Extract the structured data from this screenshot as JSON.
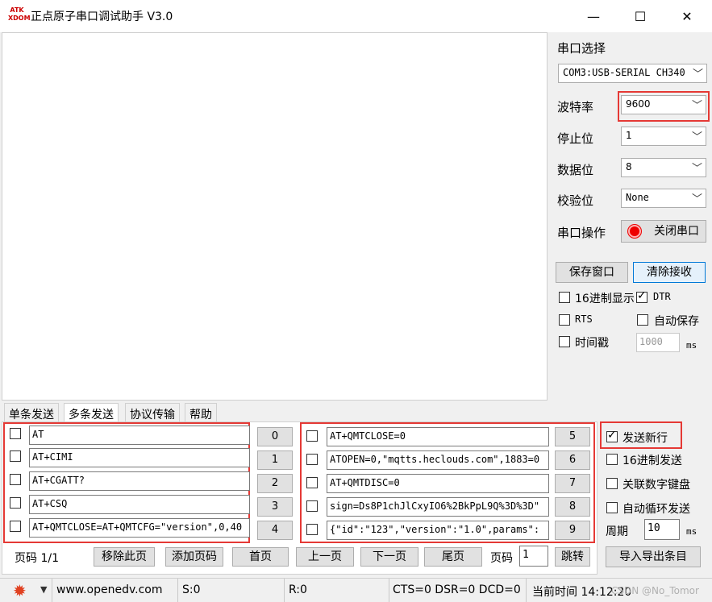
{
  "window": {
    "logo_text": "ATK XDOM",
    "title": "正点原子串口调试助手 V3.0",
    "minimize": "—",
    "maximize": "☐",
    "close": "✕"
  },
  "settings": {
    "port_select_label": "串口选择",
    "port_value": "COM3:USB-SERIAL CH340",
    "baud_label": "波特率",
    "baud_value": "9600",
    "stop_label": "停止位",
    "stop_value": "1",
    "data_label": "数据位",
    "data_value": "8",
    "parity_label": "校验位",
    "parity_value": "None",
    "port_op_label": "串口操作",
    "close_port_button": "关闭串口",
    "save_window_button": "保存窗口",
    "clear_recv_button": "清除接收",
    "hex_display": "16进制显示",
    "dtr": "DTR",
    "rts": "RTS",
    "auto_save": "自动保存",
    "timestamp": "时间戳",
    "timestamp_value": "1000",
    "timestamp_unit": "ms"
  },
  "tabs": [
    {
      "label": "单条发送",
      "active": false
    },
    {
      "label": "多条发送",
      "active": true
    },
    {
      "label": "协议传输",
      "active": false
    },
    {
      "label": "帮助",
      "active": false
    }
  ],
  "multi_send": {
    "left": [
      {
        "text": "AT",
        "num": "0"
      },
      {
        "text": "AT+CIMI",
        "num": "1"
      },
      {
        "text": "AT+CGATT?",
        "num": "2"
      },
      {
        "text": "AT+CSQ",
        "num": "3"
      },
      {
        "text": "AT+QMTCLOSE=AT+QMTCFG=\"version\",0,40",
        "num": "4"
      }
    ],
    "right": [
      {
        "text": "AT+QMTCLOSE=0",
        "num": "5"
      },
      {
        "text": "ATOPEN=0,\"mqtts.heclouds.com\",1883=0",
        "num": "6"
      },
      {
        "text": "AT+QMTDISC=0",
        "num": "7"
      },
      {
        "text": "sign=Ds8P1chJlCxyIO6%2BkPpL9Q%3D%3D\"",
        "num": "8"
      },
      {
        "text": "{\"id\":\"123\",\"version\":\"1.0\",params\":",
        "num": "9"
      }
    ],
    "send_newline": "发送新行",
    "hex_send": "16进制发送",
    "link_keypad": "关联数字键盘",
    "auto_loop": "自动循环发送",
    "period_label": "周期",
    "period_value": "10",
    "period_unit": "ms"
  },
  "pager": {
    "page_info": "页码 1/1",
    "remove_page": "移除此页",
    "add_page": "添加页码",
    "first": "首页",
    "prev": "上一页",
    "next": "下一页",
    "last": "尾页",
    "page_label": "页码",
    "page_value": "1",
    "jump": "跳转",
    "import_export": "导入导出条目"
  },
  "status": {
    "website": "www.openedv.com",
    "sent": "S:0",
    "recv": "R:0",
    "signals": "CTS=0 DSR=0 DCD=0",
    "time": "当前时间 14:12:20",
    "watermark": "CSDN @No_Tomor"
  }
}
